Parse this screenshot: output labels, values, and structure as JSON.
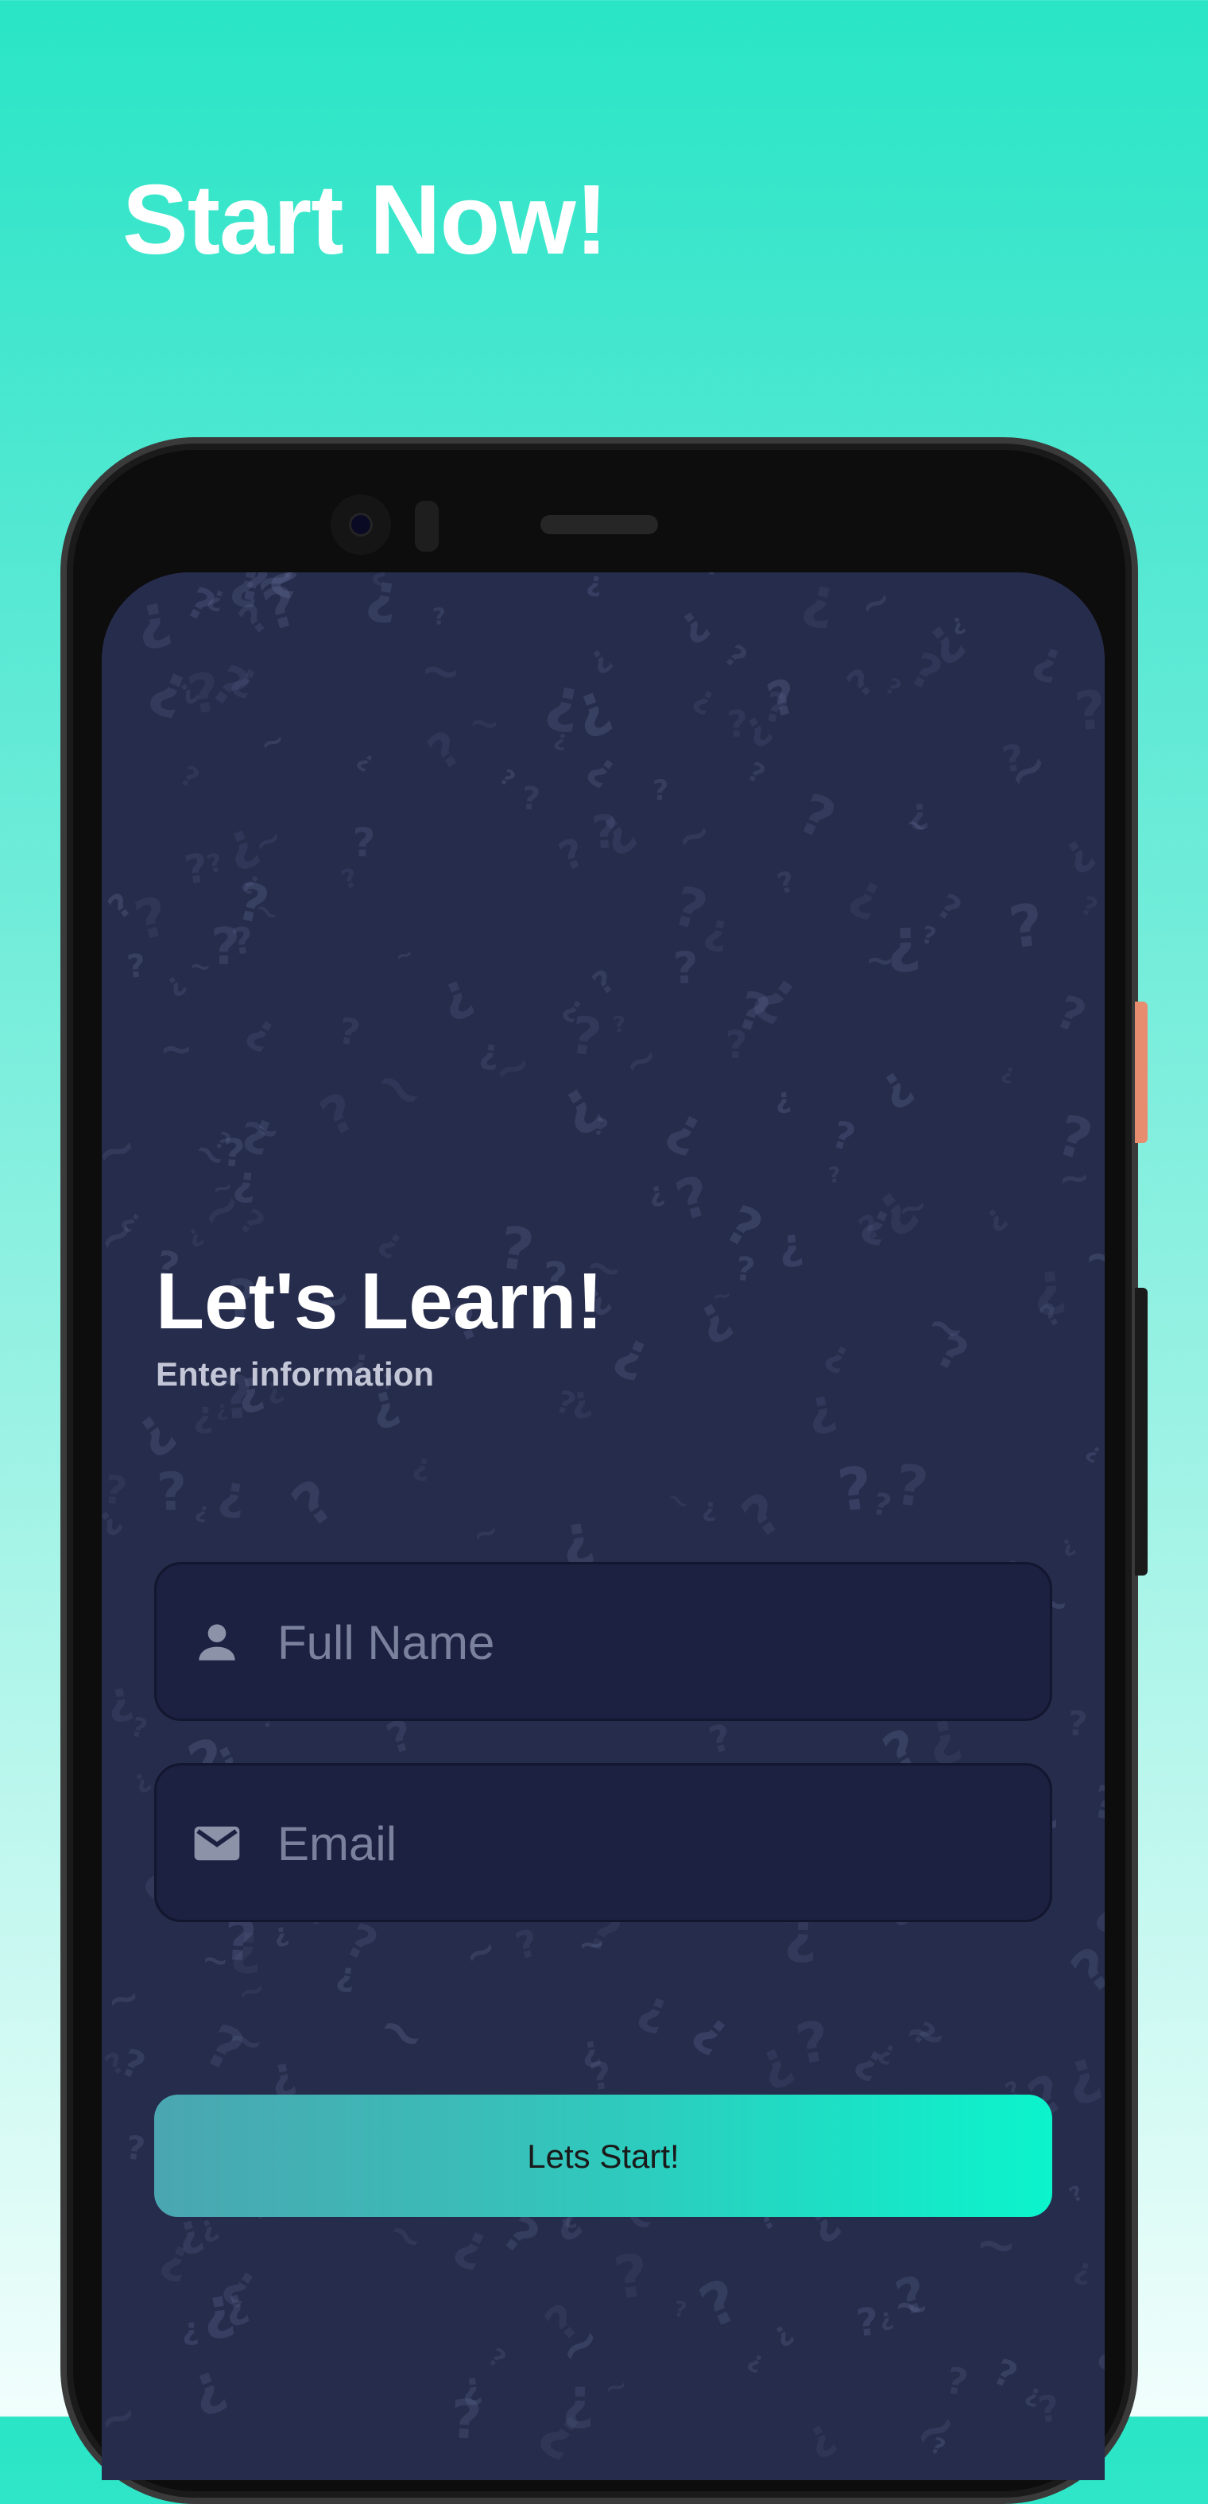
{
  "hero": {
    "headline": "Start Now!"
  },
  "screen": {
    "title": "Let's Learn!",
    "subtitle": "Enter information",
    "fields": [
      {
        "icon": "person-icon",
        "placeholder": "Full Name",
        "value": ""
      },
      {
        "icon": "email-icon",
        "placeholder": "Email",
        "value": ""
      }
    ],
    "start_button_label": "Lets Start!"
  },
  "colors": {
    "background_top": "#29e5c6",
    "background_bottom": "#f1fefc",
    "screen_background": "#262c4b",
    "field_background": "#1c2142",
    "button_gradient_start": "#4aa6b1",
    "button_gradient_end": "#0bf4cc",
    "power_button": "#e88c70"
  }
}
